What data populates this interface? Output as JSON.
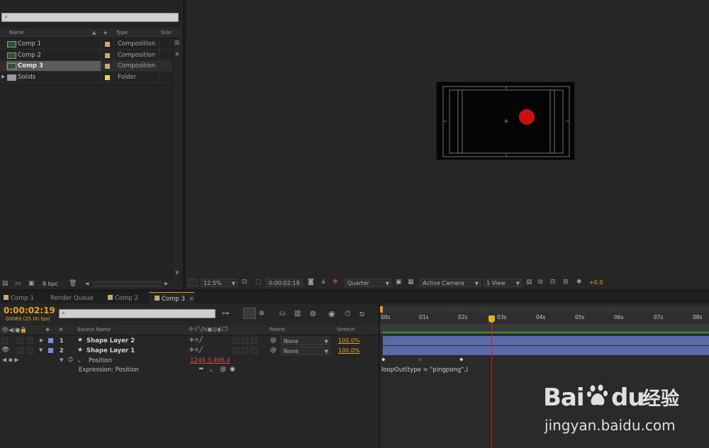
{
  "project": {
    "search_placeholder": "",
    "columns": {
      "name": "Name",
      "type": "Type",
      "size": "Size"
    },
    "items": [
      {
        "name": "Comp 1",
        "type": "Composition",
        "color": "#c3aa7d",
        "kind": "comp"
      },
      {
        "name": "Comp 2",
        "type": "Composition",
        "color": "#c3aa7d",
        "kind": "comp"
      },
      {
        "name": "Comp 3",
        "type": "Composition",
        "color": "#c3aa7d",
        "kind": "comp"
      },
      {
        "name": "Solids",
        "type": "Folder",
        "color": "#e6d15a",
        "kind": "folder"
      }
    ],
    "bpc": "8 bpc"
  },
  "viewer": {
    "zoom": "12.5%",
    "timecode": "0:00:02:19",
    "resolution": "Quarter",
    "camera": "Active Camera",
    "views": "1 View",
    "exposure": "+0.0",
    "dot_color": "#cc0f0f"
  },
  "tabs": [
    {
      "label": "Comp 1",
      "color": "#c3aa7d",
      "active": false
    },
    {
      "label": "Render Queue",
      "color": null,
      "active": false
    },
    {
      "label": "Comp 2",
      "color": "#c3aa7d",
      "active": false
    },
    {
      "label": "Comp 3",
      "color": "#c3aa7d",
      "active": true
    }
  ],
  "timeline": {
    "timecode": "0:00:02:19",
    "frame_info": "00069 (25.00 fps)",
    "search_placeholder": "",
    "columns": {
      "num": "#",
      "source": "Source Name",
      "parent": "Parent",
      "stretch": "Stretch"
    },
    "layers": [
      {
        "num": "1",
        "name": "Shape Layer 2",
        "parent": "None",
        "stretch": "100.0%"
      },
      {
        "num": "2",
        "name": "Shape Layer 1",
        "parent": "None",
        "stretch": "100.0%"
      }
    ],
    "property": {
      "name": "Position",
      "value": "1249.3,496.4"
    },
    "expression": {
      "label": "Expression: Position",
      "code": "loopOut(type = \"pingpong\",)"
    },
    "ruler": [
      "00s",
      "01s",
      "02s",
      "03s",
      "04s",
      "05s",
      "06s",
      "07s",
      "08s"
    ],
    "accent_green": "#2f9a2f",
    "bar_color": "#5a6aa8"
  },
  "watermark": {
    "brand": "Bai",
    "brand2": "du",
    "cn": "经验",
    "url": "jingyan.baidu.com"
  }
}
